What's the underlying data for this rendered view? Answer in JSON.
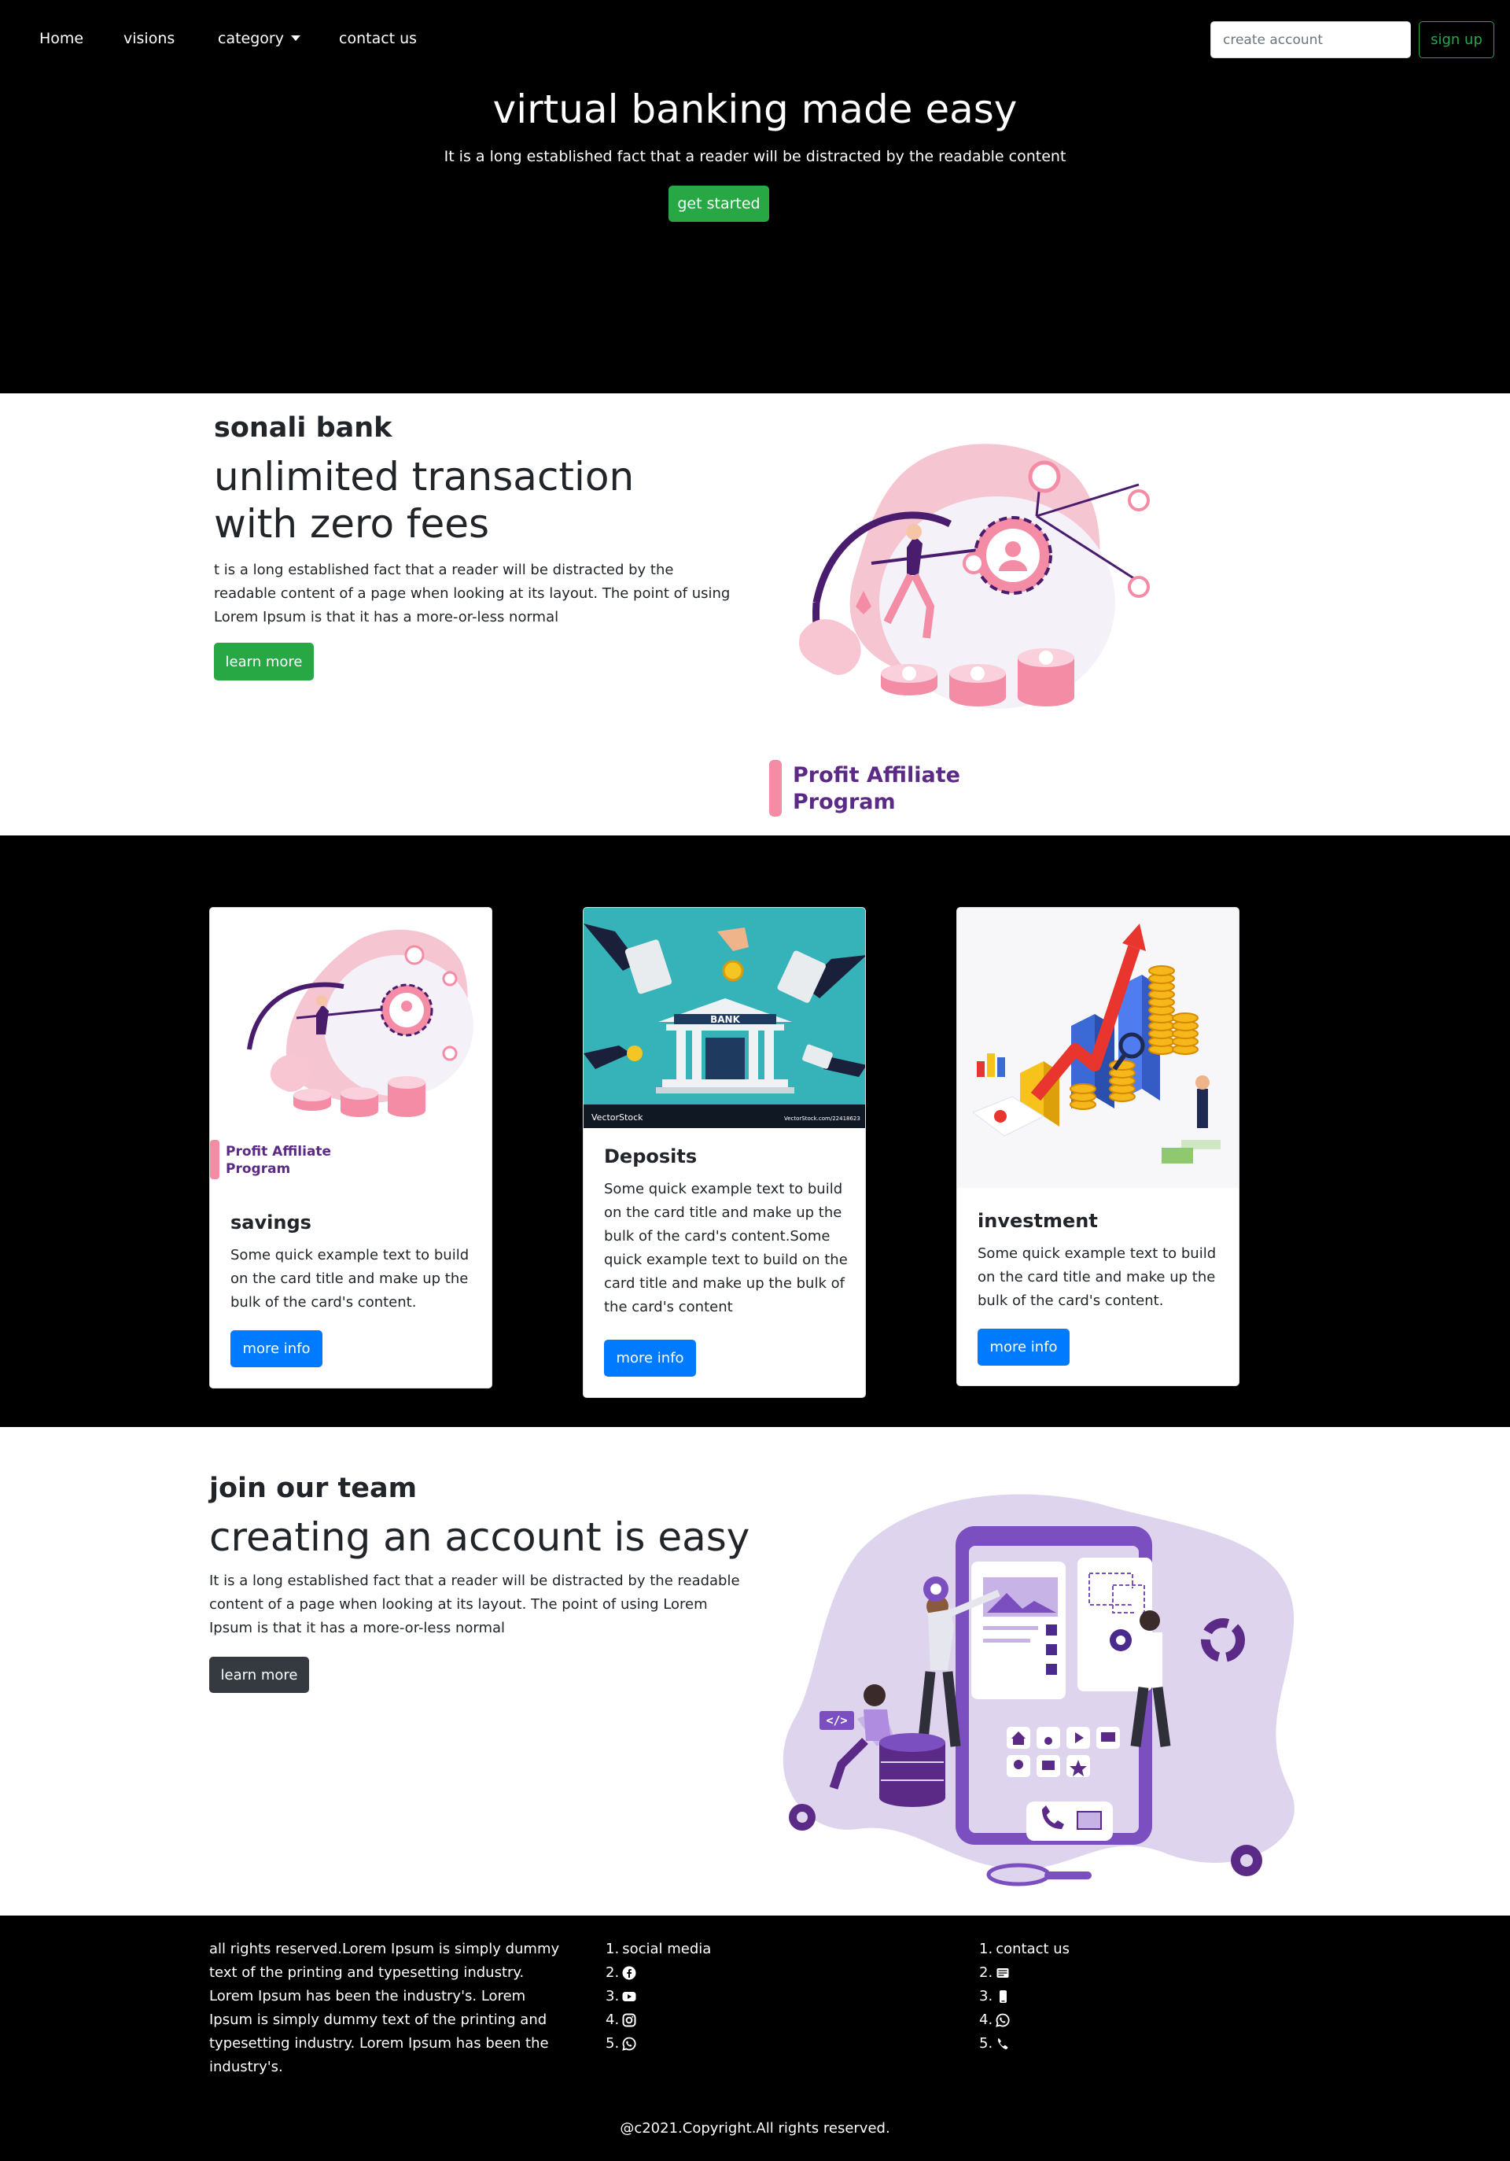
{
  "nav": {
    "items": [
      "Home",
      "visions",
      "category",
      "contact us"
    ],
    "search_placeholder": "create account",
    "signup_label": "sign up"
  },
  "hero": {
    "title": "virtual banking made easy",
    "subtitle": "It is a long established fact that a reader will be distracted by the readable content",
    "cta": "get started"
  },
  "intro": {
    "eyebrow": "sonali bank",
    "title": "unlimited transaction with zero fees",
    "text": "t is a long established fact that a reader will be distracted by the readable content of a page when looking at its layout. The point of using Lorem Ipsum is that it has a more-or-less normal",
    "button": "learn more",
    "illustration_caption": "Profit Affiliate Program"
  },
  "cards": [
    {
      "title": "savings",
      "text": "Some quick example text to build on the card title and make up the bulk of the card's content.",
      "button": "more info",
      "image_caption": "Profit Affiliate Program"
    },
    {
      "title": "Deposits",
      "text": "Some quick example text to build on the card title and make up the bulk of the card's content.Some quick example text to build on the card title and make up the bulk of the card's content",
      "button": "more info",
      "image_label": "BANK",
      "image_watermark": "VectorStock",
      "image_id": "VectorStock.com/22418623"
    },
    {
      "title": "investment",
      "text": "Some quick example text to build on the card title and make up the bulk of the card's content.",
      "button": "more info"
    }
  ],
  "team": {
    "eyebrow": "join our team",
    "title": "creating an account is easy",
    "text": "It is a long established fact that a reader will be distracted by the readable content of a page when looking at its layout. The point of using Lorem Ipsum is that it has a more-or-less normal",
    "button": "learn more",
    "code_tag": "</>"
  },
  "footer": {
    "about": "all rights reserved.Lorem Ipsum is simply dummy text of the printing and typesetting industry. Lorem Ipsum has been the industry's. Lorem Ipsum is simply dummy text of the printing and typesetting industry. Lorem Ipsum has been the industry's.",
    "social": {
      "heading": "social media",
      "numbers": [
        "1.",
        "2.",
        "3.",
        "4.",
        "5."
      ],
      "icons": [
        "facebook-icon",
        "youtube-icon",
        "instagram-icon",
        "whatsapp-icon"
      ]
    },
    "contact": {
      "heading": "contact us",
      "numbers": [
        "1.",
        "2.",
        "3.",
        "4.",
        "5."
      ],
      "icons": [
        "email-icon",
        "mobile-phone-icon",
        "whatsapp-icon",
        "phone-icon"
      ]
    },
    "copyright": "@c2021.Copyright.All rights reserved."
  },
  "colors": {
    "primary_green": "#28a745",
    "primary_blue": "#007bff",
    "dark_button": "#343a40",
    "band_black": "#000000",
    "illustration_pink": "#f4a0b5",
    "illustration_purple": "#5b2a86"
  }
}
